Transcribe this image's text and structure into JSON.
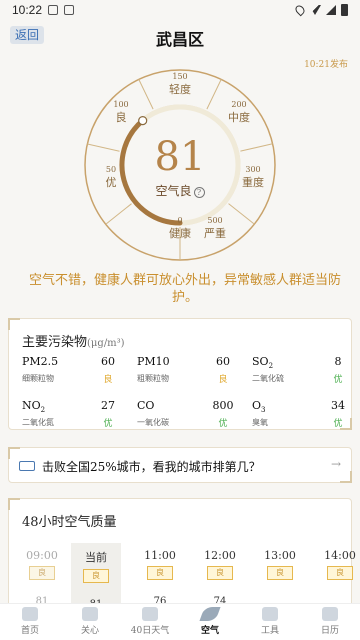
{
  "status_bar": {
    "time": "10:22"
  },
  "header": {
    "back_label": "返回",
    "district": "武昌区",
    "publish_time": "10:21发布"
  },
  "gauge": {
    "aqi": "81",
    "level_label": "空气良",
    "help_symbol": "?",
    "progress": 0.162,
    "scale": [
      {
        "num": "0",
        "txt": "健康"
      },
      {
        "num": "50",
        "txt": "优"
      },
      {
        "num": "100",
        "txt": "良"
      },
      {
        "num": "150",
        "txt": "轻度"
      },
      {
        "num": "200",
        "txt": "中度"
      },
      {
        "num": "300",
        "txt": "重度"
      },
      {
        "num": "500",
        "txt": "严重"
      }
    ]
  },
  "advice": "空气不错，健康人群可放心外出，异常敏感人群适当防护。",
  "pollutants": {
    "title": "主要污染物",
    "unit": "(μg/m³)",
    "items": [
      {
        "name": "PM2.5",
        "sub": "",
        "cn": "细颗粒物",
        "value": "60",
        "level": "良",
        "color": "#e0a82e"
      },
      {
        "name": "PM10",
        "sub": "",
        "cn": "粗颗粒物",
        "value": "60",
        "level": "良",
        "color": "#e0a82e"
      },
      {
        "name": "SO",
        "sub": "2",
        "cn": "二氧化硫",
        "value": "8",
        "level": "优",
        "color": "#4caf50"
      },
      {
        "name": "NO",
        "sub": "2",
        "cn": "二氧化氮",
        "value": "27",
        "level": "优",
        "color": "#4caf50"
      },
      {
        "name": "CO",
        "sub": "",
        "cn": "一氧化碳",
        "value": "800",
        "level": "优",
        "color": "#4caf50"
      },
      {
        "name": "O",
        "sub": "3",
        "cn": "臭氧",
        "value": "34",
        "level": "优",
        "color": "#4caf50"
      }
    ]
  },
  "rank": {
    "text": "击败全国25%城市，看我的城市排第几？",
    "arrow": "→"
  },
  "hourly": {
    "title": "48小时空气质量",
    "items": [
      {
        "time": "09:00",
        "level": "良",
        "value": "81",
        "state": "past"
      },
      {
        "time": "当前",
        "level": "良",
        "value": "81",
        "state": "cur"
      },
      {
        "time": "11:00",
        "level": "良",
        "value": "76",
        "state": ""
      },
      {
        "time": "12:00",
        "level": "良",
        "value": "74",
        "state": ""
      },
      {
        "time": "13:00",
        "level": "良",
        "value": "",
        "state": ""
      },
      {
        "time": "14:00",
        "level": "良",
        "value": "",
        "state": ""
      }
    ]
  },
  "tabs": [
    {
      "label": "首页",
      "icon": "home-icon"
    },
    {
      "label": "关心",
      "icon": "heart-icon"
    },
    {
      "label": "40日天气",
      "icon": "cloud-icon"
    },
    {
      "label": "空气",
      "icon": "leaf-icon",
      "active": true
    },
    {
      "label": "工具",
      "icon": "tools-icon"
    },
    {
      "label": "日历",
      "icon": "calendar-icon"
    }
  ]
}
